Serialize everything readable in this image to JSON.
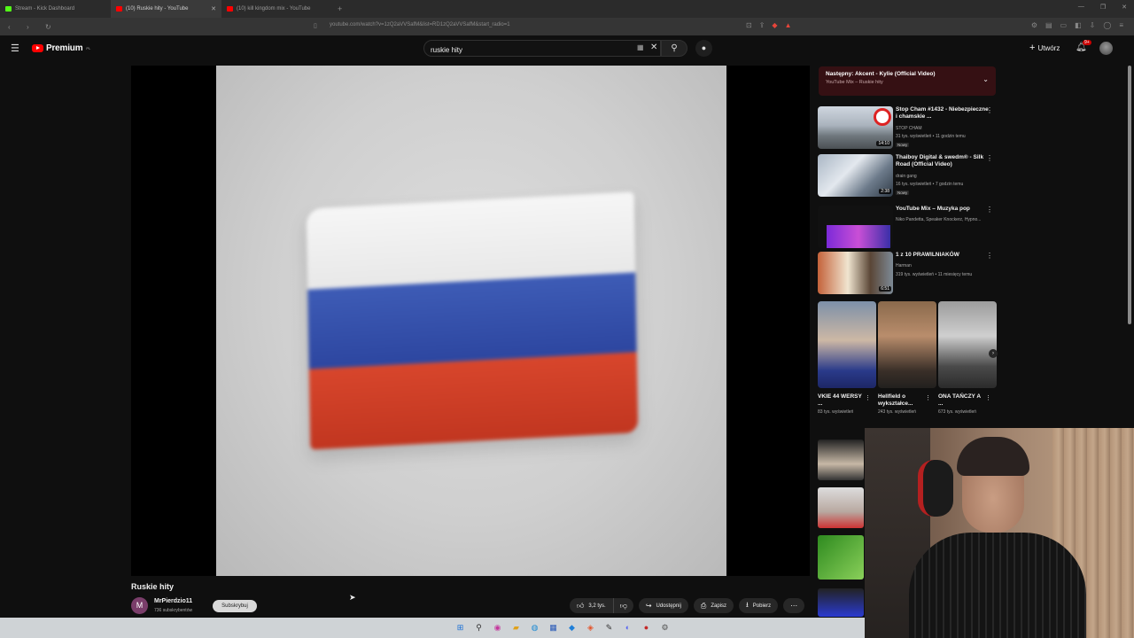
{
  "browser": {
    "tabs": [
      {
        "label": "Stream - Kick Dashboard",
        "active": false,
        "fav_color": "#53fc18"
      },
      {
        "label": "(10) Ruskie hity - YouTube",
        "active": true,
        "fav_color": "#ff0000"
      },
      {
        "label": "(10) kill kingdom mix - YouTube",
        "active": false,
        "fav_color": "#ff0000"
      }
    ],
    "url": "youtube.com/watch?v=1zQ2aVVSafM&list=RD1zQ2aVVSafM&start_radio=1"
  },
  "masthead": {
    "logo_text": "Premium",
    "logo_region": "PL",
    "search_value": "ruskie hity",
    "create_label": "Utwórz",
    "notif_badge": "9+"
  },
  "video": {
    "title": "Ruskie hity",
    "channel_initial": "M",
    "channel_name": "MrPierdzio11",
    "channel_subs": "736 subskrybentów",
    "subscribe_label": "Subskrybuj",
    "likes": "3,2 tys.",
    "share_label": "Udostępnij",
    "save_label": "Zapisz",
    "download_label": "Pobierz"
  },
  "upnext": {
    "title": "Następny: Akcent - Kylie (Official Video)",
    "subtitle": "YouTube Mix – Ruskie hity"
  },
  "recommendations": [
    {
      "title": "Stop Cham #1432 - Niebezpieczne i chamskie ...",
      "channel": "STOP CHAM",
      "views": "31 tys. wyświetleń • 11 godzin temu",
      "badge": "Nowy",
      "duration": "14:10",
      "thumb": "stopcham"
    },
    {
      "title": "Thaiboy Digital & swedm® - Silk Road (Official Video)",
      "channel": "drain gang",
      "views": "16 tys. wyświetleń • 7 godzin temu",
      "badge": "Nowy",
      "duration": "2:38",
      "thumb": "thaiboy"
    },
    {
      "title": "YouTube Mix – Muzyka pop",
      "channel": "Niko Pandetta, Speaker Knockerz, Hypno...",
      "views": "",
      "badge": "",
      "duration": "",
      "thumb": "mix"
    },
    {
      "title": "1 z 10 PRAWILNIAKÓW",
      "channel": "Harman",
      "views": "319 tys. wyświetleń • 11 miesięcy temu",
      "badge": "",
      "duration": "6:51",
      "thumb": "jeden"
    }
  ],
  "shorts": [
    {
      "title": "VKIE 44 WERSY ...",
      "views": "83 tys. wyświetleń"
    },
    {
      "title": "Hellfield o wykształce...",
      "views": "243 tys. wyświetleń"
    },
    {
      "title": "ONA TAŃCZY A ...",
      "views": "673 tys. wyświetleń"
    }
  ]
}
